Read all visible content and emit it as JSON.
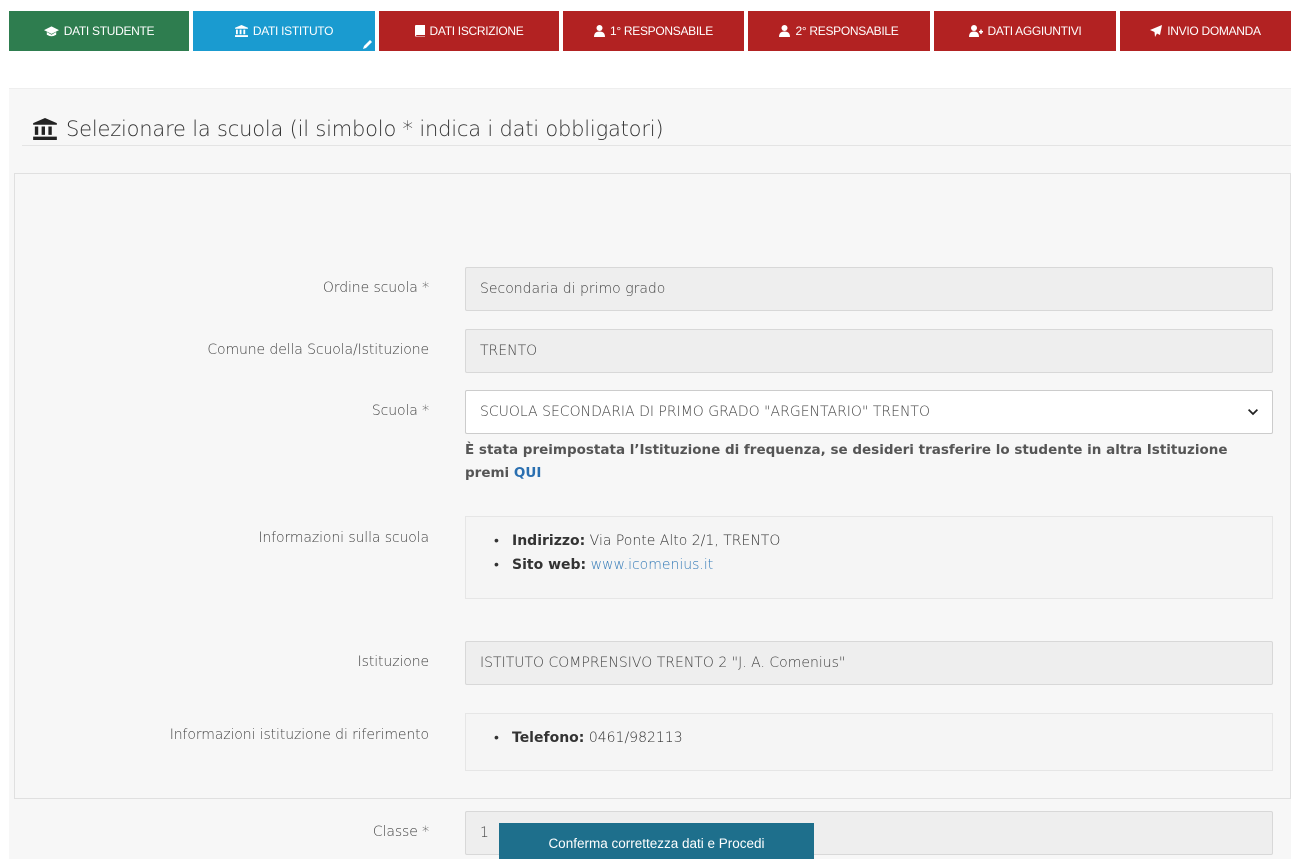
{
  "tabs": [
    {
      "label": "DATI STUDENTE",
      "icon": "graduation-cap-icon",
      "color": "#2e7d4f"
    },
    {
      "label": "DATI ISTITUTO",
      "icon": "institution-icon",
      "color": "#1a9bd0",
      "active": true
    },
    {
      "label": "DATI ISCRIZIONE",
      "icon": "book-icon",
      "color": "#b22222"
    },
    {
      "label": "1° RESPONSABILE",
      "icon": "user-icon",
      "color": "#b22222"
    },
    {
      "label": "2° RESPONSABILE",
      "icon": "user-icon",
      "color": "#b22222"
    },
    {
      "label": "DATI AGGIUNTIVI",
      "icon": "user-plus-icon",
      "color": "#b22222"
    },
    {
      "label": "INVIO DOMANDA",
      "icon": "paper-plane-icon",
      "color": "#b22222"
    }
  ],
  "section": {
    "title": "Selezionare la scuola (il simbolo * indica i dati obbligatori)",
    "icon": "institution-icon"
  },
  "form": {
    "ordine": {
      "label": "Ordine scuola *",
      "value": "Secondaria di primo grado"
    },
    "comune": {
      "label": "Comune della Scuola/Istituzione",
      "value": "TRENTO"
    },
    "scuola": {
      "label": "Scuola *",
      "value": "SCUOLA SECONDARIA DI PRIMO GRADO \"ARGENTARIO\" TRENTO"
    },
    "notice": {
      "text": "È stata preimpostata l’Istituzione di frequenza, se desideri trasferire lo studente in altra Istituzione premi ",
      "link": "QUI"
    },
    "info_scuola": {
      "label": "Informazioni sulla scuola",
      "indirizzo_label": "Indirizzo:",
      "indirizzo_value": "Via Ponte Alto 2/1, TRENTO",
      "sito_label": "Sito web:",
      "sito_value": "www.icomenius.it"
    },
    "istituzione": {
      "label": "Istituzione",
      "value": "ISTITUTO COMPRENSIVO TRENTO 2 \"J. A. Comenius\""
    },
    "info_istituzione": {
      "label": "Informazioni istituzione di riferimento",
      "telefono_label": "Telefono:",
      "telefono_value": "0461/982113"
    },
    "classe": {
      "label": "Classe *",
      "value": "1"
    }
  },
  "submit_label": "Conferma correttezza dati e Procedi",
  "colors": {
    "accent_blue": "#1a9bd0",
    "tab_red": "#b22222",
    "tab_green": "#2e7d4f",
    "button": "#1e6f8c",
    "link": "#337ab7"
  }
}
